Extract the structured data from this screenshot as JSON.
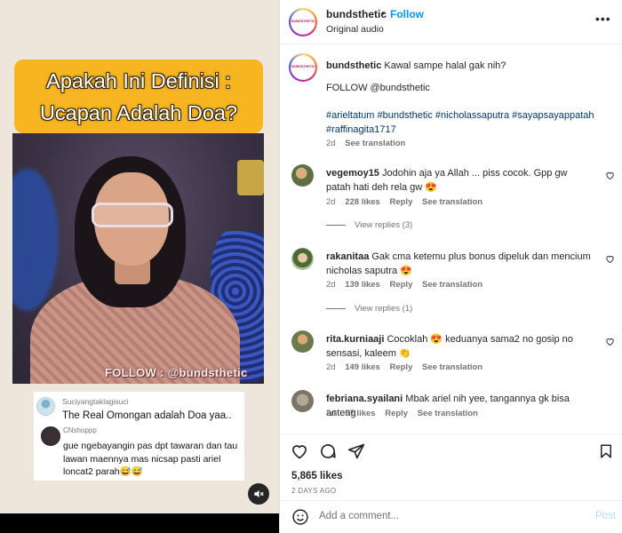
{
  "media": {
    "headline": "Apakah Ini Definisi : Ucapan Adalah Doa?",
    "watermark": "FOLLOW : @bundsthetic",
    "embedded_comment_1": {
      "username": "Suciyangtaklagisuci",
      "text": "The Real Omongan adalah Doa yaa.."
    },
    "embedded_comment_2": {
      "username": "CNshoppp",
      "text": "gue ngebayangin pas dpt tawaran dan tau lawan maennya mas nicsap pasti ariel loncat2 parah😅😅"
    },
    "mute_icon": "speaker-muted-icon"
  },
  "header": {
    "avatar_text": "BUNDSTHETIC",
    "username": "bundsthetic",
    "dot": "•",
    "follow_label": "Follow",
    "audio": "Original audio",
    "more_icon": "•••"
  },
  "caption": {
    "username": "bundsthetic",
    "text": "Kawal sampe halal gak nih?",
    "follow_line": "FOLLOW @bundsthetic",
    "tags": "#arieltatum #bundsthetic #nicholassaputra #sayapsayappatah #raffinagita1717",
    "time": "2d",
    "see_translation": "See translation"
  },
  "comments": [
    {
      "username": "vegemoy15",
      "text": "Jodohin aja ya Allah ... piss cocok. Gpp gw patah hati deh rela gw 😍",
      "time": "2d",
      "likes": "228 likes",
      "reply": "Reply",
      "see_translation": "See translation",
      "view_replies": "View replies (3)"
    },
    {
      "username": "rakanitaa",
      "text": "Gak cma ketemu plus bonus dipeluk dan mencium nicholas saputra 😍",
      "time": "2d",
      "likes": "139 likes",
      "reply": "Reply",
      "see_translation": "See translation",
      "view_replies": "View replies (1)"
    },
    {
      "username": "rita.kurniaaji",
      "text": "Cocoklah 😍 keduanya sama2 no gosip no sensasi, kaleem 👏",
      "time": "2d",
      "likes": "149 likes",
      "reply": "Reply",
      "see_translation": "See translation"
    },
    {
      "username": "febriana.syailani",
      "text": "Mbak ariel nih yee, tangannya gk bisa anteng",
      "time": "2d",
      "likes": "57 likes",
      "reply": "Reply",
      "see_translation": "See translation"
    }
  ],
  "actions": {
    "like_icon": "heart-outline-icon",
    "comment_icon": "comment-bubble-icon",
    "share_icon": "paper-plane-icon",
    "save_icon": "bookmark-icon",
    "likes": "5,865 likes",
    "date": "2 DAYS AGO"
  },
  "add_comment": {
    "emoji_icon": "smiley-icon",
    "placeholder": "Add a comment...",
    "post_label": "Post"
  },
  "colors": {
    "accent_blue": "#0095f6",
    "hashtag_blue": "#00376b",
    "headline_yellow": "#f6b521",
    "muted_text": "#737373",
    "post_disabled": "#b2dffc"
  }
}
